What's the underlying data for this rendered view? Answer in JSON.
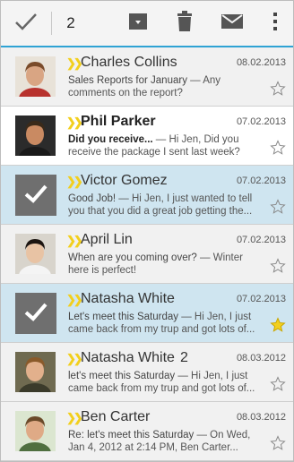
{
  "actionbar": {
    "selected_count": "2",
    "icons": [
      "checkmark-icon",
      "archive-icon",
      "trash-icon",
      "mail-icon",
      "overflow-menu-icon"
    ]
  },
  "messages": [
    {
      "sender": "Charles Collins",
      "count": "",
      "date": "08.02.2013",
      "subject": "Sales Reports for January",
      "preview": " — Any comments on the report?",
      "state": "read",
      "selected": false,
      "starred": false
    },
    {
      "sender": "Phil Parker",
      "count": "",
      "date": "07.02.2013",
      "subject": "Did you receive...",
      "preview": " — Hi Jen, Did you receive the package I sent last week?",
      "state": "unread",
      "selected": false,
      "starred": false
    },
    {
      "sender": "Victor Gomez",
      "count": "",
      "date": "07.02.2013",
      "subject": "Good Job!",
      "preview": " — Hi Jen, I just wanted to tell you that you did a great job getting the...",
      "state": "read",
      "selected": true,
      "starred": false
    },
    {
      "sender": "April Lin",
      "count": "",
      "date": "07.02.2013",
      "subject": "When are you coming over?",
      "preview": " — Winter here is perfect!",
      "state": "read",
      "selected": false,
      "starred": false
    },
    {
      "sender": "Natasha White",
      "count": "",
      "date": "07.02.2013",
      "subject": "Let's meet this Saturday",
      "preview": " — Hi Jen, I just came back from my trup and got lots of...",
      "state": "read",
      "selected": true,
      "starred": true
    },
    {
      "sender": "Natasha White",
      "count": "2",
      "date": "08.03.2012",
      "subject": "let's meet this Saturday",
      "preview": " — Hi Jen, I just came back from my trup and got lots of...",
      "state": "read",
      "selected": false,
      "starred": false
    },
    {
      "sender": "Ben Carter",
      "count": "",
      "date": "08.03.2012",
      "subject": "Re: let's meet this Saturday",
      "preview": " — On Wed, Jan 4, 2012 at 2:14 PM, Ben Carter...",
      "state": "read",
      "selected": false,
      "starred": false
    }
  ],
  "colors": {
    "accent": "#2fa3d4",
    "star": "#f2cf1d",
    "selected_bg": "#cfe5f0"
  }
}
